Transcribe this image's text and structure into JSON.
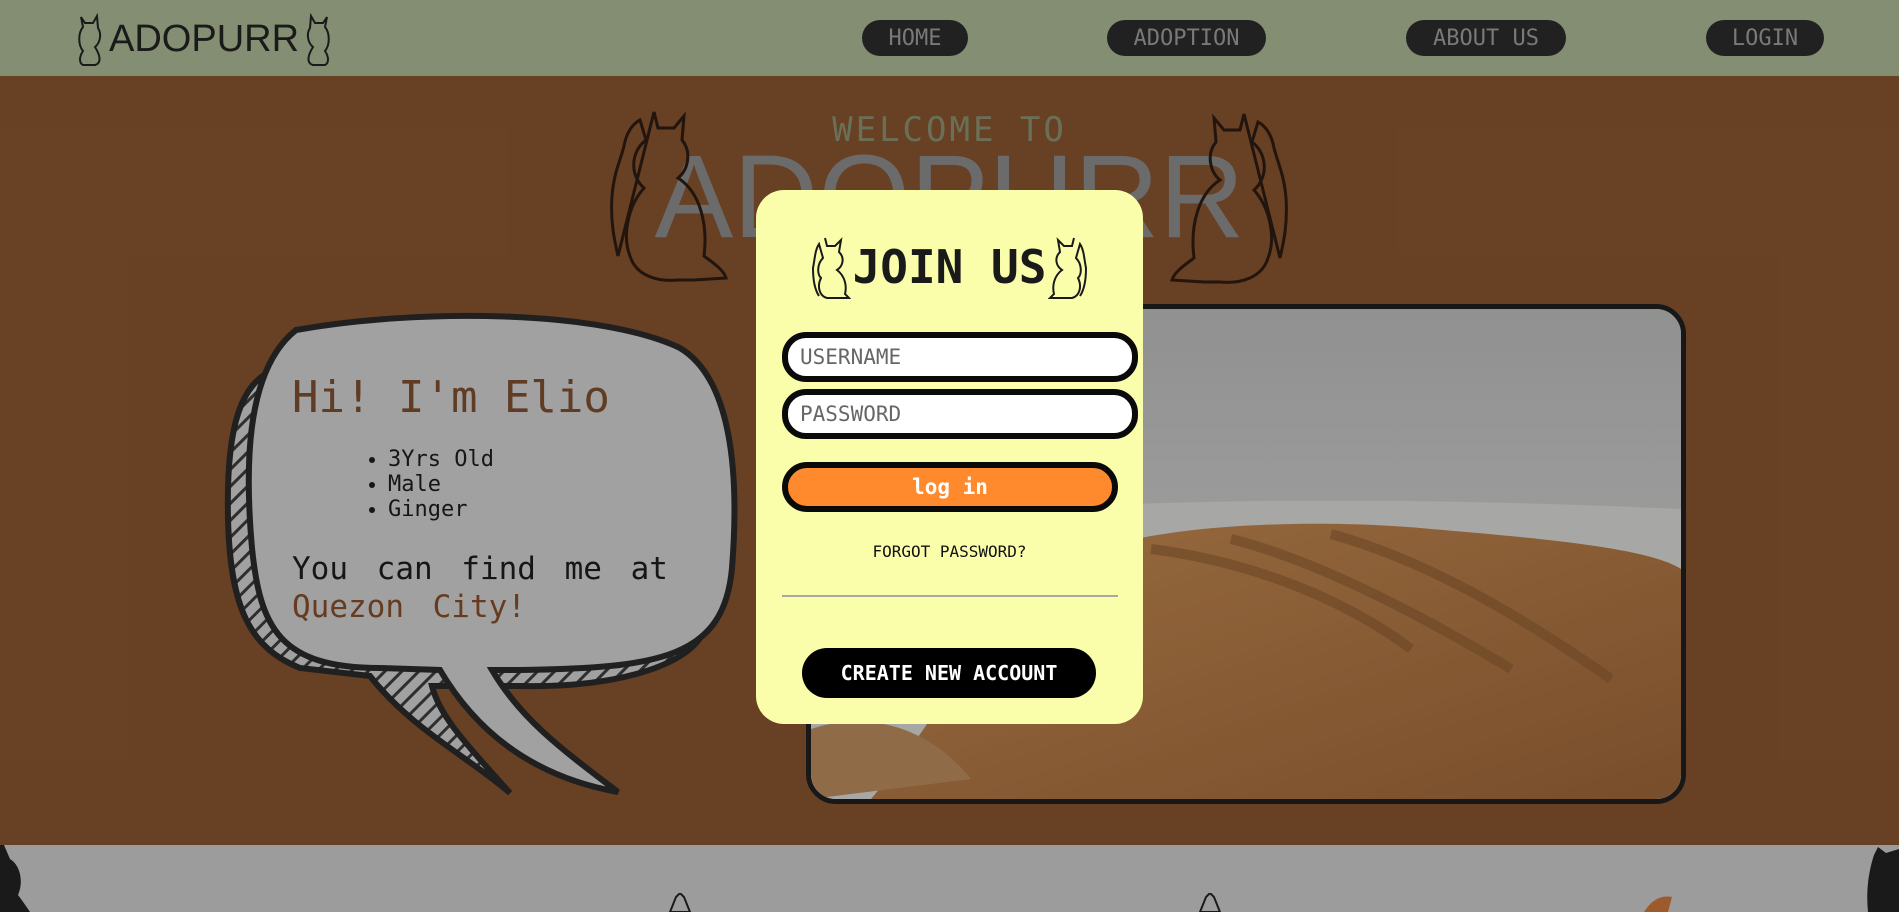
{
  "nav": {
    "logo_text": "ADOPURR",
    "links": [
      "HOME",
      "ADOPTION",
      "ABOUT US",
      "LOGIN"
    ]
  },
  "hero": {
    "welcome": "WELCOME TO",
    "brand": "ADOPURR"
  },
  "bubble": {
    "title": "Hi! I'm Elio",
    "facts": [
      "3Yrs Old",
      "Male",
      "Ginger"
    ],
    "find_prefix": "You can find me at",
    "city": "Quezon City!"
  },
  "modal": {
    "title": "JOIN US",
    "username_placeholder": "USERNAME",
    "password_placeholder": "PASSWORD",
    "login_label": "log in",
    "forgot_label": "FORGOT PASSWORD?",
    "create_label": "CREATE NEW ACCOUNT"
  },
  "colors": {
    "nav_bg": "#a8b792",
    "hero_bg": "#86532f",
    "modal_bg": "#fafeaa",
    "login_btn": "#ff8a2d",
    "nav_btn": "#2b2b2b"
  },
  "icons": [
    "cat-silhouette-icon",
    "cat-outline-icon"
  ]
}
